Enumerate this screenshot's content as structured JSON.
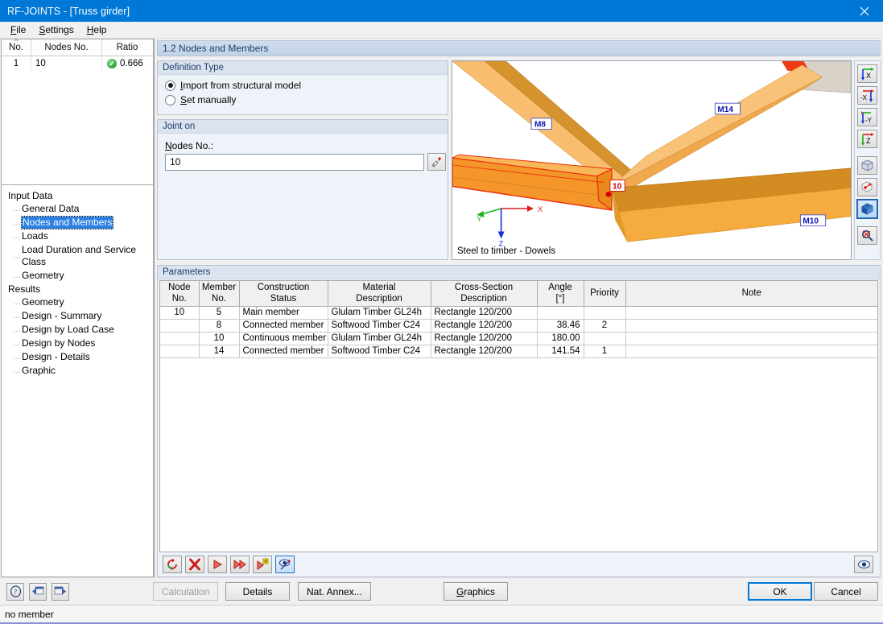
{
  "window": {
    "title": "RF-JOINTS - [Truss girder]",
    "close_icon": "close-icon"
  },
  "menu": {
    "items": [
      {
        "label": "File",
        "accel": "F"
      },
      {
        "label": "Settings",
        "accel": "S"
      },
      {
        "label": "Help",
        "accel": "H"
      }
    ]
  },
  "joint_list": {
    "columns": [
      "No.",
      "Nodes No.",
      "Ratio"
    ],
    "rows": [
      {
        "no": "1",
        "nodes_no": "10",
        "ratio": "0.666",
        "status_icon": "check-circle-icon"
      }
    ]
  },
  "tree": {
    "groups": [
      {
        "label": "Input Data",
        "items": [
          {
            "label": "General Data",
            "selected": false
          },
          {
            "label": "Nodes and Members",
            "selected": true
          },
          {
            "label": "Loads",
            "selected": false
          },
          {
            "label": "Load Duration and Service Class",
            "selected": false
          },
          {
            "label": "Geometry",
            "selected": false
          }
        ]
      },
      {
        "label": "Results",
        "items": [
          {
            "label": "Geometry",
            "selected": false
          },
          {
            "label": "Design - Summary",
            "selected": false
          },
          {
            "label": "Design by Load Case",
            "selected": false
          },
          {
            "label": "Design by Nodes",
            "selected": false
          },
          {
            "label": "Design - Details",
            "selected": false
          },
          {
            "label": "Graphic",
            "selected": false
          }
        ]
      }
    ]
  },
  "section": {
    "title": "1.2 Nodes and Members"
  },
  "definition_type": {
    "title": "Definition Type",
    "options": [
      {
        "label": "Import from structural model",
        "selected": true
      },
      {
        "label": "Set manually",
        "selected": false
      }
    ]
  },
  "joint_on": {
    "title": "Joint on",
    "field_label": "Nodes No.:",
    "value": "10",
    "picker_icon": "pick-node-icon"
  },
  "viewport": {
    "caption": "Steel to timber - Dowels",
    "member_labels": [
      "M8",
      "M14",
      "M10"
    ],
    "node_label": "10",
    "axes": {
      "x": "X",
      "y": "Y",
      "z": "Z"
    },
    "colors": {
      "timber_light": "#f6b55a",
      "timber_mid": "#f0a03c",
      "timber_dark": "#c97f21",
      "highlight": "#ff3b14",
      "axis_x": "#e01b1b",
      "axis_y": "#17b417",
      "axis_z": "#1430d8",
      "steel_grey": "#d8d0c6"
    },
    "toolbar_buttons": [
      {
        "name": "view-in-x-icon",
        "label": "X"
      },
      {
        "name": "view-in-minus-x-icon",
        "label": "-X"
      },
      {
        "name": "view-in-minus-y-icon",
        "label": "-Y"
      },
      {
        "name": "view-in-z-icon",
        "label": "Z"
      },
      {
        "name": "isometric-view-icon",
        "label": ""
      },
      {
        "name": "view-rotate-icon",
        "label": ""
      },
      {
        "name": "render-solid-icon",
        "label": ""
      },
      {
        "name": "zoom-reset-icon",
        "label": ""
      }
    ]
  },
  "parameters": {
    "title": "Parameters",
    "columns": [
      {
        "line1": "Node",
        "line2": "No."
      },
      {
        "line1": "Member",
        "line2": "No."
      },
      {
        "line1": "Construction",
        "line2": "Status"
      },
      {
        "line1": "Material",
        "line2": "Description"
      },
      {
        "line1": "Cross-Section",
        "line2": "Description"
      },
      {
        "line1": "Angle",
        "line2": "[°]"
      },
      {
        "line1": "Priority",
        "line2": ""
      },
      {
        "line1": "Note",
        "line2": ""
      }
    ],
    "rows": [
      {
        "node_no": "10",
        "member_no": "5",
        "status": "Main member",
        "material": "Glulam Timber GL24h",
        "section": "Rectangle 120/200",
        "angle": "",
        "priority": "",
        "note": ""
      },
      {
        "node_no": "",
        "member_no": "8",
        "status": "Connected member",
        "material": "Softwood Timber C24",
        "section": "Rectangle 120/200",
        "angle": "38.46",
        "priority": "2",
        "note": ""
      },
      {
        "node_no": "",
        "member_no": "10",
        "status": "Continuous member",
        "material": "Glulam Timber GL24h",
        "section": "Rectangle 120/200",
        "angle": "180.00",
        "priority": "",
        "note": ""
      },
      {
        "node_no": "",
        "member_no": "14",
        "status": "Connected member",
        "material": "Softwood Timber C24",
        "section": "Rectangle 120/200",
        "angle": "141.54",
        "priority": "1",
        "note": ""
      }
    ],
    "toolbar_buttons": [
      {
        "name": "refresh-icon"
      },
      {
        "name": "delete-row-icon"
      },
      {
        "name": "next-icon"
      },
      {
        "name": "fast-forward-icon"
      },
      {
        "name": "add-row-icon"
      },
      {
        "name": "visibility-edit-icon"
      }
    ],
    "view_button": {
      "name": "eye-icon"
    }
  },
  "actionbar": {
    "icon_buttons": [
      {
        "name": "help-icon"
      },
      {
        "name": "import-icon"
      },
      {
        "name": "export-icon"
      }
    ],
    "buttons": [
      {
        "label": "Calculation",
        "disabled": true,
        "name": "calculation-button"
      },
      {
        "label": "Details",
        "disabled": false,
        "name": "details-button"
      },
      {
        "label": "Nat. Annex...",
        "disabled": false,
        "name": "nat-annex-button"
      },
      {
        "label": "Graphics",
        "disabled": false,
        "name": "graphics-button"
      },
      {
        "label": "OK",
        "disabled": false,
        "name": "ok-button"
      },
      {
        "label": "Cancel",
        "disabled": false,
        "name": "cancel-button"
      }
    ]
  },
  "statusbar": {
    "text": "no member"
  }
}
